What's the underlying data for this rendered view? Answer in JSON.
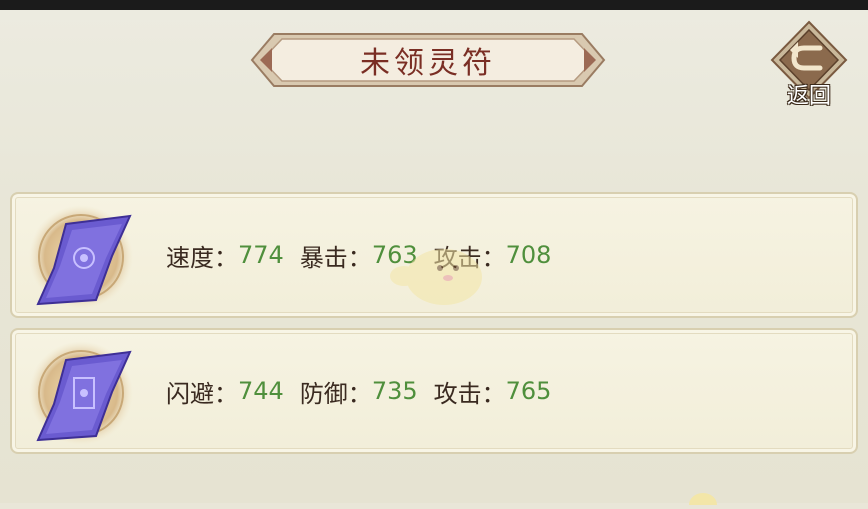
{
  "header": {
    "title": "未领灵符",
    "back_label": "返回"
  },
  "cards": [
    {
      "stats": [
        {
          "label": "速度：",
          "value": "774"
        },
        {
          "label": "暴击：",
          "value": "763"
        },
        {
          "label": "攻击：",
          "value": "708"
        }
      ]
    },
    {
      "stats": [
        {
          "label": "闪避：",
          "value": "744"
        },
        {
          "label": "防御：",
          "value": "735"
        },
        {
          "label": "攻击：",
          "value": "765"
        }
      ]
    }
  ],
  "colors": {
    "title_text": "#7a2e24",
    "stat_value": "#4f8f3c",
    "stat_label": "#3a2a20",
    "talisman": "#6a5bd0"
  }
}
